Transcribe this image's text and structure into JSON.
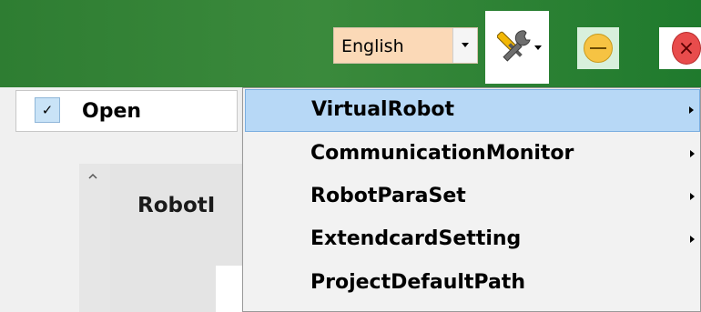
{
  "titlebar": {
    "language": {
      "value": "English"
    },
    "tools_icon": "wrench-screwdriver-icon",
    "minimize_icon": "minimize-circle-icon",
    "close_icon": "close-circle-icon",
    "close_glyph": "×"
  },
  "open_item": {
    "check": "✓",
    "label": "Open"
  },
  "background": {
    "title": "RobotI"
  },
  "submenu": {
    "items": [
      {
        "label": "VirtualRobot",
        "has_submenu": true,
        "highlighted": true
      },
      {
        "label": "CommunicationMonitor",
        "has_submenu": true,
        "highlighted": false
      },
      {
        "label": "RobotParaSet",
        "has_submenu": true,
        "highlighted": false
      },
      {
        "label": "ExtendcardSetting",
        "has_submenu": true,
        "highlighted": false
      },
      {
        "label": "ProjectDefaultPath",
        "has_submenu": false,
        "highlighted": false
      }
    ]
  },
  "colors": {
    "titlebar": "#2e7d32",
    "highlight": "#b7d8f6",
    "language_bg": "#fbd9b7"
  }
}
